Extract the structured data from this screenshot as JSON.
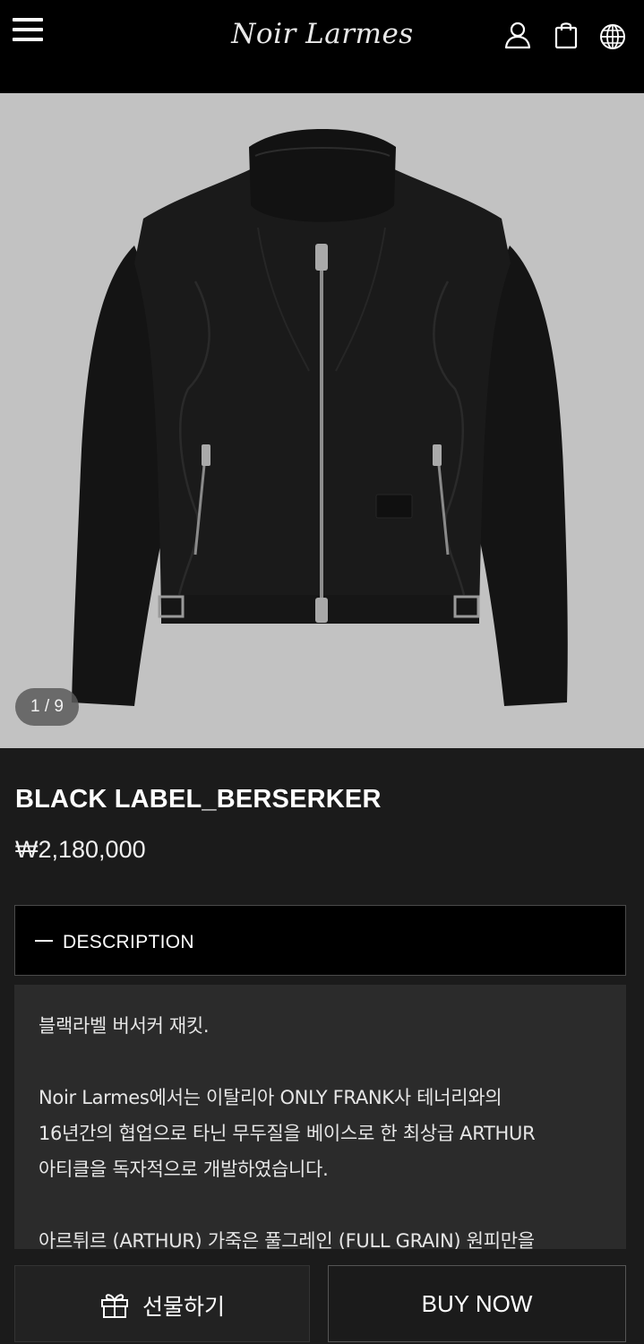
{
  "header": {
    "logo_text": "Noir Larmes",
    "icons": [
      "menu-icon",
      "user-icon",
      "shopping-bag-icon",
      "globe-icon"
    ]
  },
  "gallery": {
    "counter": "1 / 9"
  },
  "product": {
    "title": "BLACK LABEL_BERSERKER",
    "price": "₩2,180,000"
  },
  "description": {
    "toggle_label": "DESCRIPTION",
    "lines": [
      "블랙라벨 버서커 재킷.",
      "Noir Larmes에서는 이탈리아 ONLY FRANK사 테너리와의",
      "16년간의 협업으로 타닌 무두질을 베이스로 한 최상급 ARTHUR",
      "아티클을 독자적으로 개발하였습니다.",
      "아르튀르 (ARTHUR) 가죽은 풀그레인 (FULL GRAIN) 원피만을"
    ]
  },
  "actions": {
    "gift_label": "선물하기",
    "buy_label": "BUY NOW"
  },
  "colors": {
    "header_bg": "#000000",
    "page_bg": "#1b1b1b",
    "image_bg": "#c2c2c2",
    "desc_bg": "#2b2b2b"
  }
}
